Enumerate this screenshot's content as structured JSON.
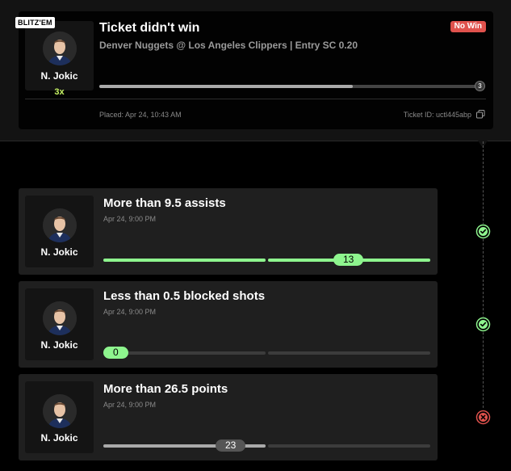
{
  "colors": {
    "green": "#8ef58e",
    "red": "#e0524d",
    "accent": "#c7f464",
    "gray": "#aaaaaa"
  },
  "ticket": {
    "badge": "BLITZ'EM",
    "player_name": "N. Jokic",
    "multiplier": "3x",
    "title": "Ticket didn't win",
    "subtitle": "Denver Nuggets @ Los Angeles Clippers | Entry SC 0.20",
    "status": "No Win",
    "progress_fraction": 0.67,
    "legs_total": "3",
    "placed": "Placed: Apr 24, 10:43 AM",
    "ticket_id": "Ticket ID: uctl445abp",
    "copy_icon": "copy-icon"
  },
  "legs": [
    {
      "player_name": "N. Jokic",
      "title": "More than 9.5 assists",
      "time": "Apr 24, 9:00 PM",
      "value": "13",
      "line": 9.5,
      "stat": 13,
      "result": "won",
      "icon": "check-circle-icon"
    },
    {
      "player_name": "N. Jokic",
      "title": "Less than 0.5 blocked shots",
      "time": "Apr 24, 9:00 PM",
      "value": "0",
      "line": 0.5,
      "stat": 0,
      "result": "won",
      "icon": "check-circle-icon"
    },
    {
      "player_name": "N. Jokic",
      "title": "More than 26.5 points",
      "time": "Apr 24, 9:00 PM",
      "value": "23",
      "line": 26.5,
      "stat": 23,
      "result": "lost",
      "icon": "x-circle-icon"
    }
  ]
}
